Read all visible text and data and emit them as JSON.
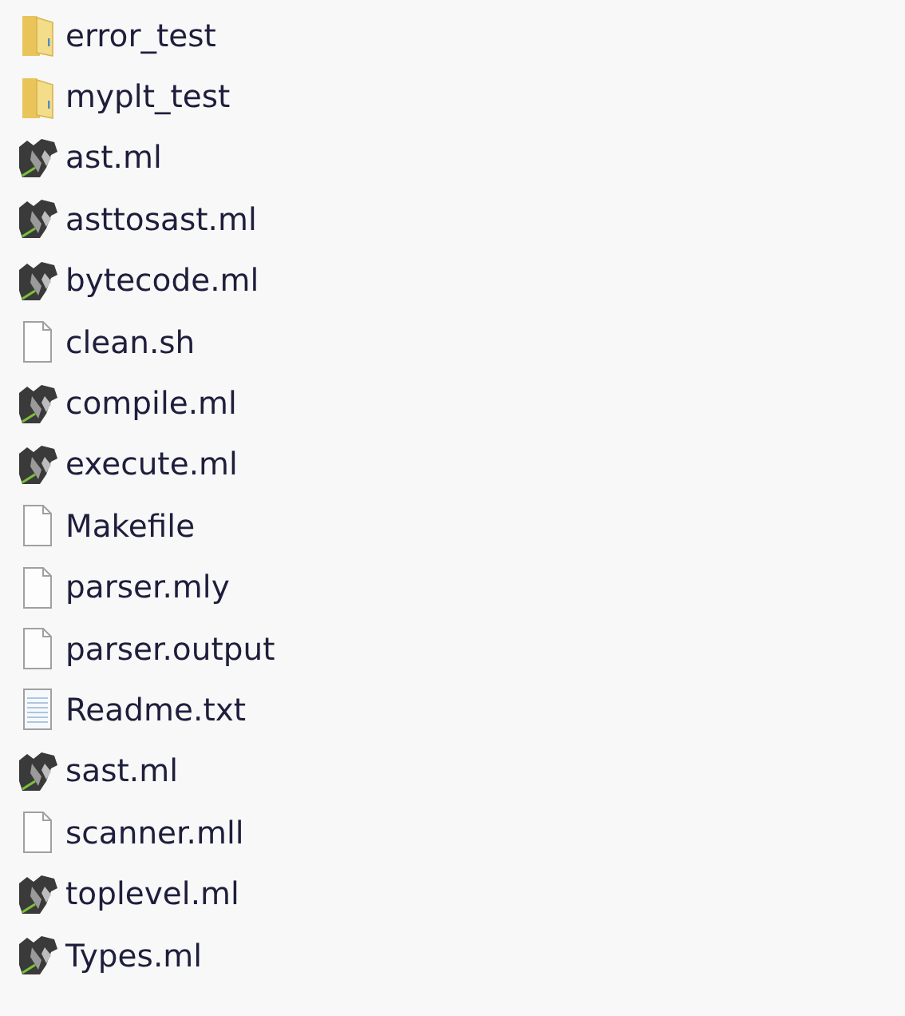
{
  "files": [
    {
      "name": "error_test",
      "kind": "folder"
    },
    {
      "name": "myplt_test",
      "kind": "folder"
    },
    {
      "name": "ast.ml",
      "kind": "ml"
    },
    {
      "name": "asttosast.ml",
      "kind": "ml"
    },
    {
      "name": "bytecode.ml",
      "kind": "ml"
    },
    {
      "name": "clean.sh",
      "kind": "blank"
    },
    {
      "name": "compile.ml",
      "kind": "ml"
    },
    {
      "name": "execute.ml",
      "kind": "ml"
    },
    {
      "name": "Makefile",
      "kind": "blank"
    },
    {
      "name": "parser.mly",
      "kind": "blank"
    },
    {
      "name": "parser.output",
      "kind": "blank"
    },
    {
      "name": "Readme.txt",
      "kind": "text"
    },
    {
      "name": "sast.ml",
      "kind": "ml"
    },
    {
      "name": "scanner.mll",
      "kind": "blank"
    },
    {
      "name": "toplevel.ml",
      "kind": "ml"
    },
    {
      "name": "Types.ml",
      "kind": "ml"
    }
  ]
}
